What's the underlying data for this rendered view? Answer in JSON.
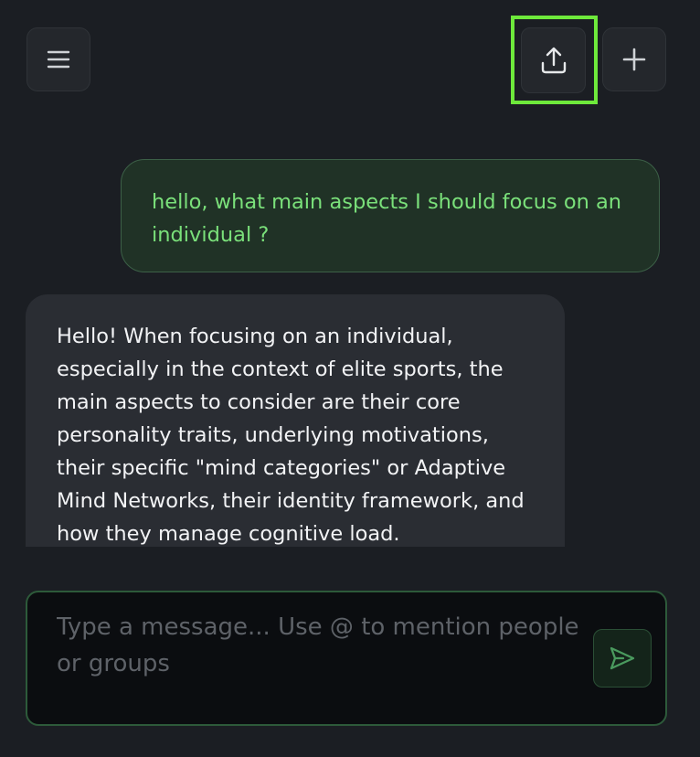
{
  "header": {
    "menu_icon": "hamburger-menu-icon",
    "share_icon": "upload-share-icon",
    "new_chat_icon": "plus-icon"
  },
  "conversation": {
    "messages": [
      {
        "role": "user",
        "text": "hello, what main aspects I should focus on an individual ?"
      },
      {
        "role": "assistant",
        "text": "Hello! When focusing on an individual, especially in the context of elite sports, the main aspects to consider are their core personality traits, underlying motivations, their specific \"mind categories\" or Adaptive Mind Networks, their identity framework, and how they manage cognitive load."
      }
    ]
  },
  "composer": {
    "placeholder": "Type a message... Use @ to mention people or groups",
    "value": "",
    "send_icon": "send-arrow-icon"
  },
  "colors": {
    "background": "#1b1e23",
    "user_bubble": "#203226",
    "user_text": "#7ae07a",
    "assistant_bubble": "#2a2d33",
    "accent_green": "#6ee93b",
    "composer_border": "#2d5a3a"
  }
}
